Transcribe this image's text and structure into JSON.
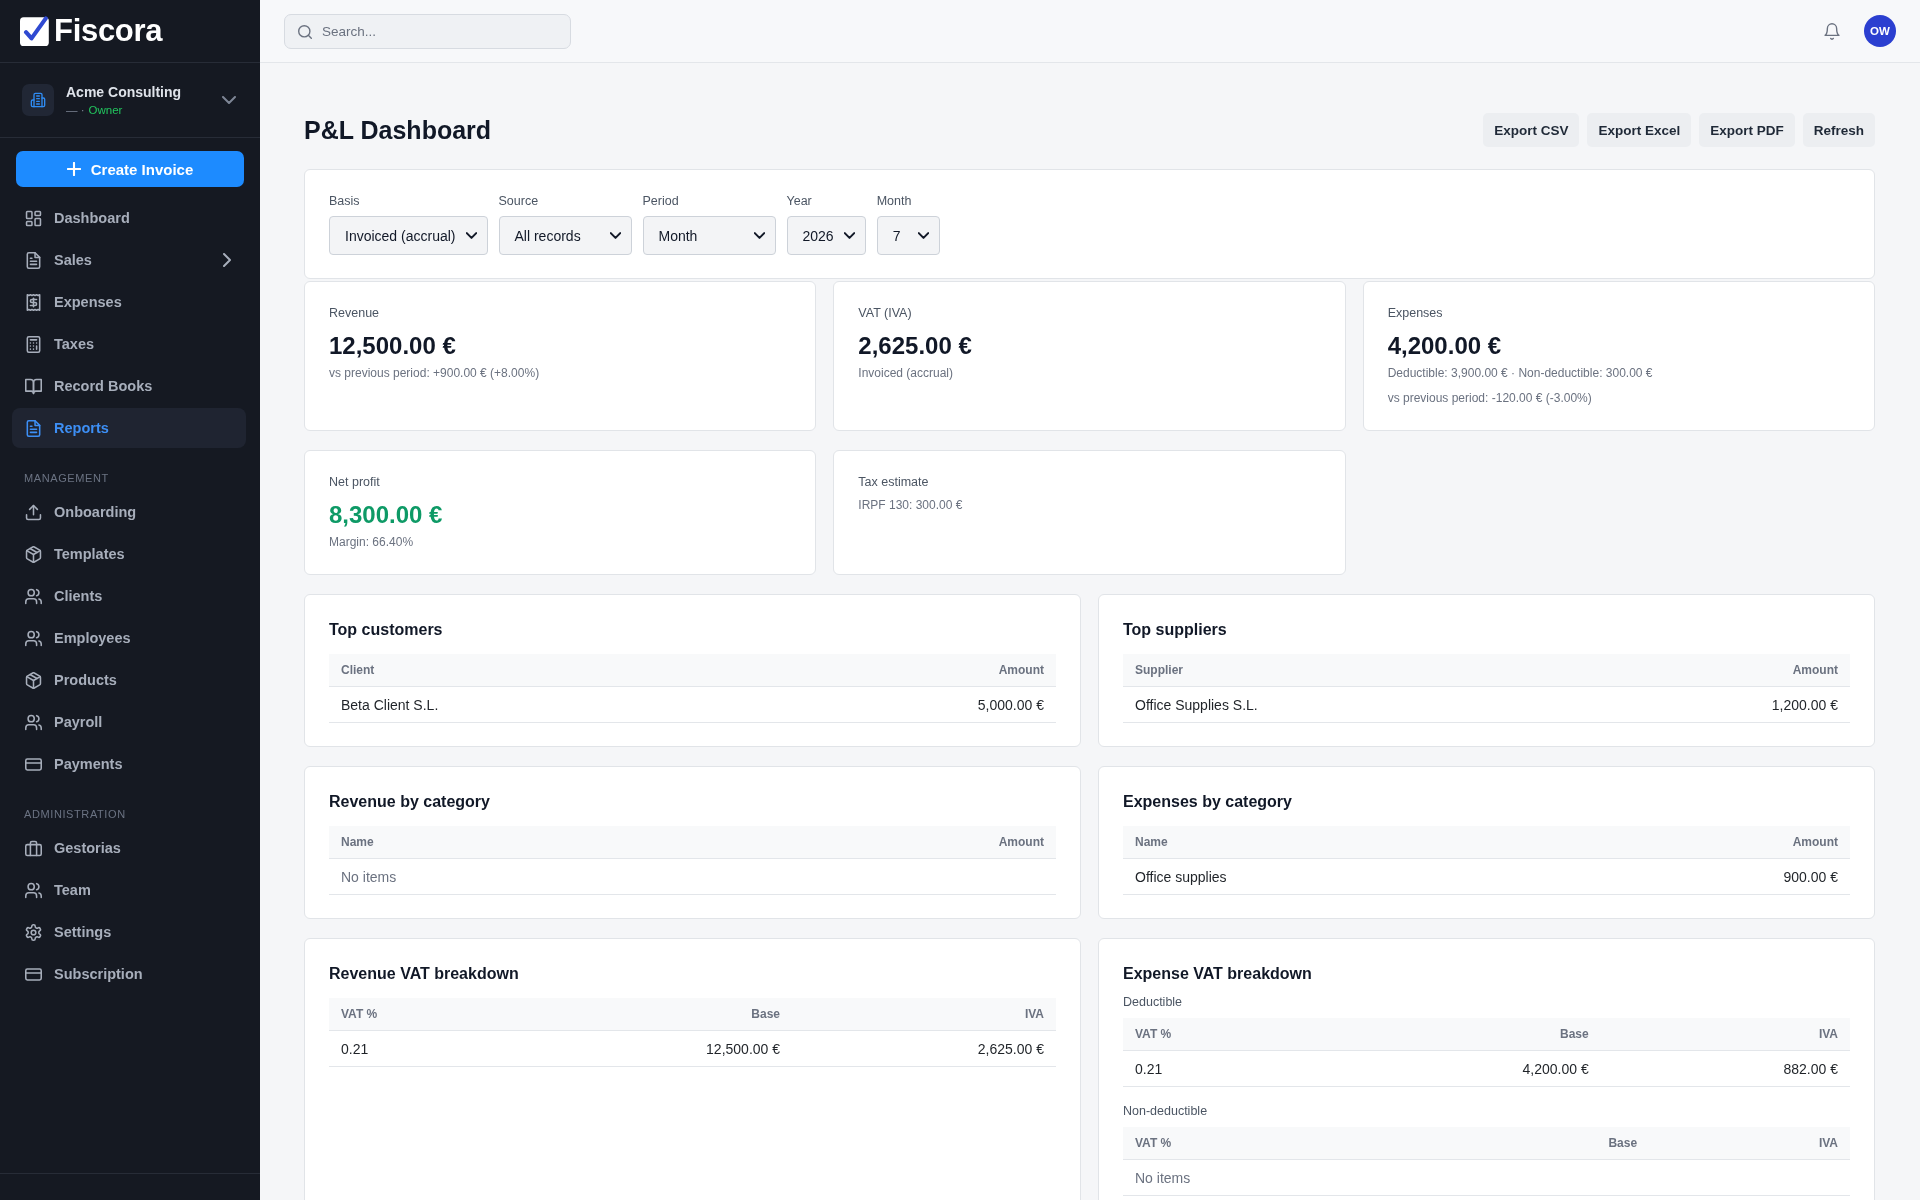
{
  "sidebar": {
    "logo": "Fiscora",
    "organization": {
      "name": "Acme Consulting",
      "subtitle": "— ·",
      "role": "Owner"
    },
    "primary_action": "Create Invoice",
    "sections": [
      {
        "items": [
          {
            "label": "Dashboard",
            "kind": "link",
            "selected": false
          },
          {
            "label": "Sales",
            "kind": "group",
            "selected": false
          },
          {
            "label": "Expenses",
            "kind": "link",
            "selected": false
          },
          {
            "label": "Taxes",
            "kind": "link",
            "selected": false
          },
          {
            "label": "Record Books",
            "kind": "link",
            "selected": false
          },
          {
            "label": "Reports",
            "kind": "link",
            "selected": true
          }
        ]
      },
      {
        "heading": "MANAGEMENT",
        "items": [
          {
            "label": "Onboarding",
            "kind": "link",
            "selected": false
          },
          {
            "label": "Templates",
            "kind": "link",
            "selected": false
          },
          {
            "label": "Clients",
            "kind": "link",
            "selected": false
          },
          {
            "label": "Employees",
            "kind": "link",
            "selected": false
          },
          {
            "label": "Products",
            "kind": "link",
            "selected": false
          },
          {
            "label": "Payroll",
            "kind": "link",
            "selected": false
          },
          {
            "label": "Payments",
            "kind": "link",
            "selected": false
          }
        ]
      },
      {
        "heading": "ADMINISTRATION",
        "items": [
          {
            "label": "Gestorias",
            "kind": "link",
            "selected": false
          },
          {
            "label": "Team",
            "kind": "link",
            "selected": false
          },
          {
            "label": "Settings",
            "kind": "link",
            "selected": false
          },
          {
            "label": "Subscription",
            "kind": "link",
            "selected": false
          }
        ]
      }
    ]
  },
  "topbar": {
    "search": {
      "placeholder": "Search..."
    },
    "avatar": "OW"
  },
  "page": {
    "title": "P&L Dashboard",
    "actions": [
      "Export CSV",
      "Export Excel",
      "Export PDF",
      "Refresh"
    ]
  },
  "filters": [
    {
      "label": "Basis",
      "value": "Invoiced (accrual)"
    },
    {
      "label": "Source",
      "value": "All records"
    },
    {
      "label": "Period",
      "value": "Month"
    },
    {
      "label": "Year",
      "value": "2026"
    },
    {
      "label": "Month",
      "value": "7"
    }
  ],
  "kpis": [
    {
      "label": "Revenue",
      "value": "12,500.00 €",
      "positive": false,
      "notes": [
        "vs previous period: +900.00 € (+8.00%)"
      ]
    },
    {
      "label": "VAT (IVA)",
      "value": "2,625.00 €",
      "positive": false,
      "notes": [
        "Invoiced (accrual)"
      ]
    },
    {
      "label": "Expenses",
      "value": "4,200.00 €",
      "positive": false,
      "notes": [
        "Deductible: 3,900.00 € · Non-deductible: 300.00 €",
        "vs previous period: -120.00 € (-3.00%)"
      ]
    },
    {
      "label": "Net profit",
      "value": "8,300.00 €",
      "positive": true,
      "notes": [
        "Margin: 66.40%"
      ]
    },
    {
      "label": "Tax estimate",
      "notes": [
        "IRPF 130: 300.00 €"
      ]
    }
  ],
  "sections": [
    {
      "title": "Top customers",
      "tables": [
        {
          "columns": [
            "Client",
            "Amount"
          ],
          "rows": [
            [
              "Beta Client S.L.",
              "5,000.00 €"
            ]
          ]
        }
      ]
    },
    {
      "title": "Top suppliers",
      "tables": [
        {
          "columns": [
            "Supplier",
            "Amount"
          ],
          "rows": [
            [
              "Office Supplies S.L.",
              "1,200.00 €"
            ]
          ]
        }
      ]
    },
    {
      "title": "Revenue by category",
      "tables": [
        {
          "columns": [
            "Name",
            "Amount"
          ],
          "empty_text": "No items"
        }
      ]
    },
    {
      "title": "Expenses by category",
      "tables": [
        {
          "columns": [
            "Name",
            "Amount"
          ],
          "rows": [
            [
              "Office supplies",
              "900.00 €"
            ]
          ]
        }
      ]
    },
    {
      "title": "Revenue VAT breakdown",
      "tables": [
        {
          "columns": [
            "VAT %",
            "Base",
            "IVA"
          ],
          "rows": [
            [
              "0.21",
              "12,500.00 €",
              "2,625.00 €"
            ]
          ]
        }
      ]
    },
    {
      "title": "Expense VAT breakdown",
      "tables": [
        {
          "caption": "Deductible",
          "columns": [
            "VAT %",
            "Base",
            "IVA"
          ],
          "rows": [
            [
              "0.21",
              "4,200.00 €",
              "882.00 €"
            ]
          ]
        },
        {
          "caption": "Non-deductible",
          "columns": [
            "VAT %",
            "Base",
            "IVA"
          ],
          "empty_text": "No items"
        }
      ]
    }
  ]
}
